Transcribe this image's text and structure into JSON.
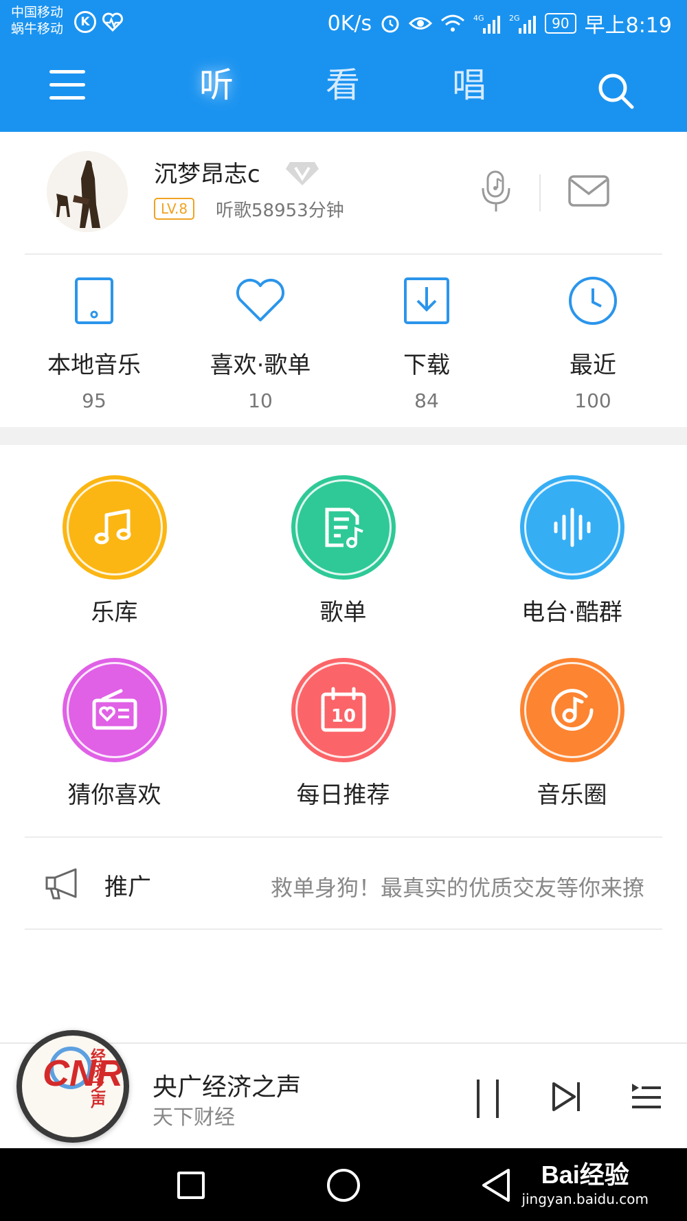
{
  "status_bar": {
    "carrier1": "中国移动",
    "carrier2": "蜗牛移动",
    "k_icon": "K",
    "speed": "0K/s",
    "net4g": "4G",
    "net2g": "2G",
    "battery": "90",
    "time": "早上8:19"
  },
  "header": {
    "tabs": [
      {
        "label": "听",
        "active": true
      },
      {
        "label": "看",
        "active": false
      },
      {
        "label": "唱",
        "active": false
      }
    ],
    "bg_color": "#1a93f0"
  },
  "profile": {
    "username": "沉梦昂志c",
    "level": "LV.8",
    "listen_time": "听歌58953分钟"
  },
  "quick_items": [
    {
      "label": "本地音乐",
      "count": "95",
      "icon": "tablet-icon"
    },
    {
      "label": "喜欢·歌单",
      "count": "10",
      "icon": "heart-icon"
    },
    {
      "label": "下载",
      "count": "84",
      "icon": "download-icon"
    },
    {
      "label": "最近",
      "count": "100",
      "icon": "clock-icon"
    }
  ],
  "grid_items": [
    {
      "label": "乐库",
      "color": "#fbb613",
      "icon": "music-note-icon"
    },
    {
      "label": "歌单",
      "color": "#2ec996",
      "icon": "playlist-icon"
    },
    {
      "label": "电台·酷群",
      "color": "#36aef4",
      "icon": "soundwave-icon"
    },
    {
      "label": "猜你喜欢",
      "color": "#e060e6",
      "icon": "radio-heart-icon"
    },
    {
      "label": "每日推荐",
      "color": "#fb6468",
      "icon": "calendar-icon",
      "calendar_day": "10"
    },
    {
      "label": "音乐圈",
      "color": "#fd8431",
      "icon": "music-circle-icon"
    }
  ],
  "promo": {
    "label": "推广",
    "text": "救单身狗！最真实的优质交友等你来撩"
  },
  "player": {
    "title": "央广经济之声",
    "subtitle": "天下财经",
    "logo_text": "CNR",
    "logo_cn": "经济之声"
  },
  "watermark": {
    "brand": "Bai经验",
    "url": "jingyan.baidu.com"
  }
}
